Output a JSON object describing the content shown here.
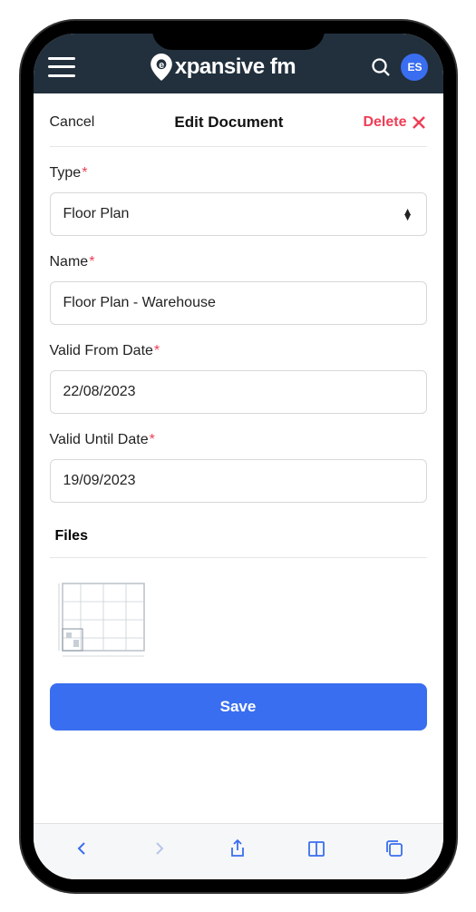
{
  "header": {
    "brand": "xpansive fm",
    "avatar_initials": "ES"
  },
  "modal": {
    "cancel_label": "Cancel",
    "title": "Edit Document",
    "delete_label": "Delete"
  },
  "form": {
    "type_label": "Type",
    "type_value": "Floor Plan",
    "name_label": "Name",
    "name_value": "Floor Plan - Warehouse",
    "valid_from_label": "Valid From Date",
    "valid_from_value": "22/08/2023",
    "valid_until_label": "Valid Until Date",
    "valid_until_value": "19/09/2023",
    "files_label": "Files",
    "save_label": "Save"
  }
}
